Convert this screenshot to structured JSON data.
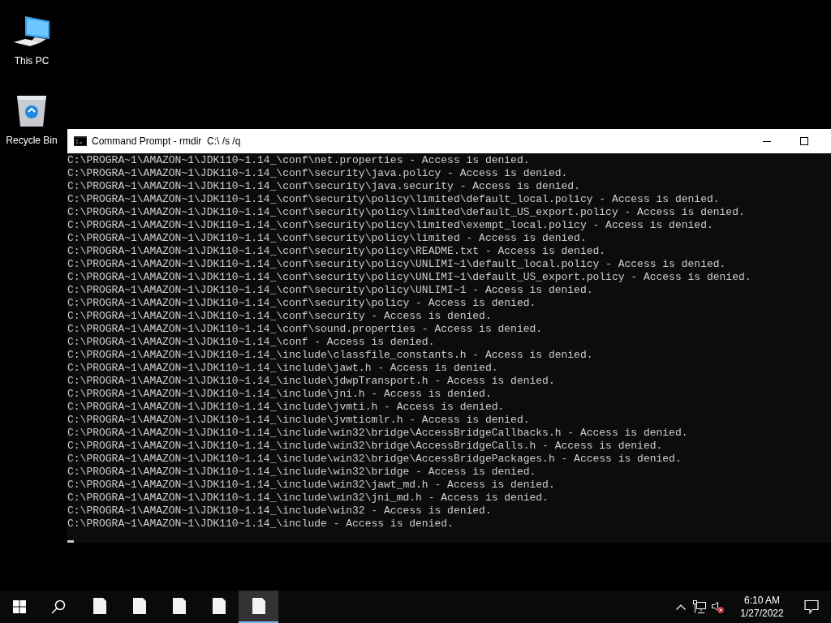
{
  "desktop_icons": [
    {
      "kind": "computer",
      "label": "This PC"
    },
    {
      "kind": "recycle",
      "label": "Recycle Bin"
    }
  ],
  "window": {
    "title": "Command Prompt - rmdir  C:\\ /s /q",
    "lines": [
      "C:\\PROGRA~1\\AMAZON~1\\JDK110~1.14_\\conf\\net.properties - Access is denied.",
      "C:\\PROGRA~1\\AMAZON~1\\JDK110~1.14_\\conf\\security\\java.policy - Access is denied.",
      "C:\\PROGRA~1\\AMAZON~1\\JDK110~1.14_\\conf\\security\\java.security - Access is denied.",
      "C:\\PROGRA~1\\AMAZON~1\\JDK110~1.14_\\conf\\security\\policy\\limited\\default_local.policy - Access is denied.",
      "C:\\PROGRA~1\\AMAZON~1\\JDK110~1.14_\\conf\\security\\policy\\limited\\default_US_export.policy - Access is denied.",
      "C:\\PROGRA~1\\AMAZON~1\\JDK110~1.14_\\conf\\security\\policy\\limited\\exempt_local.policy - Access is denied.",
      "C:\\PROGRA~1\\AMAZON~1\\JDK110~1.14_\\conf\\security\\policy\\limited - Access is denied.",
      "C:\\PROGRA~1\\AMAZON~1\\JDK110~1.14_\\conf\\security\\policy\\README.txt - Access is denied.",
      "C:\\PROGRA~1\\AMAZON~1\\JDK110~1.14_\\conf\\security\\policy\\UNLIMI~1\\default_local.policy - Access is denied.",
      "C:\\PROGRA~1\\AMAZON~1\\JDK110~1.14_\\conf\\security\\policy\\UNLIMI~1\\default_US_export.policy - Access is denied.",
      "C:\\PROGRA~1\\AMAZON~1\\JDK110~1.14_\\conf\\security\\policy\\UNLIMI~1 - Access is denied.",
      "C:\\PROGRA~1\\AMAZON~1\\JDK110~1.14_\\conf\\security\\policy - Access is denied.",
      "C:\\PROGRA~1\\AMAZON~1\\JDK110~1.14_\\conf\\security - Access is denied.",
      "C:\\PROGRA~1\\AMAZON~1\\JDK110~1.14_\\conf\\sound.properties - Access is denied.",
      "C:\\PROGRA~1\\AMAZON~1\\JDK110~1.14_\\conf - Access is denied.",
      "C:\\PROGRA~1\\AMAZON~1\\JDK110~1.14_\\include\\classfile_constants.h - Access is denied.",
      "C:\\PROGRA~1\\AMAZON~1\\JDK110~1.14_\\include\\jawt.h - Access is denied.",
      "C:\\PROGRA~1\\AMAZON~1\\JDK110~1.14_\\include\\jdwpTransport.h - Access is denied.",
      "C:\\PROGRA~1\\AMAZON~1\\JDK110~1.14_\\include\\jni.h - Access is denied.",
      "C:\\PROGRA~1\\AMAZON~1\\JDK110~1.14_\\include\\jvmti.h - Access is denied.",
      "C:\\PROGRA~1\\AMAZON~1\\JDK110~1.14_\\include\\jvmticmlr.h - Access is denied.",
      "C:\\PROGRA~1\\AMAZON~1\\JDK110~1.14_\\include\\win32\\bridge\\AccessBridgeCallbacks.h - Access is denied.",
      "C:\\PROGRA~1\\AMAZON~1\\JDK110~1.14_\\include\\win32\\bridge\\AccessBridgeCalls.h - Access is denied.",
      "C:\\PROGRA~1\\AMAZON~1\\JDK110~1.14_\\include\\win32\\bridge\\AccessBridgePackages.h - Access is denied.",
      "C:\\PROGRA~1\\AMAZON~1\\JDK110~1.14_\\include\\win32\\bridge - Access is denied.",
      "C:\\PROGRA~1\\AMAZON~1\\JDK110~1.14_\\include\\win32\\jawt_md.h - Access is denied.",
      "C:\\PROGRA~1\\AMAZON~1\\JDK110~1.14_\\include\\win32\\jni_md.h - Access is denied.",
      "C:\\PROGRA~1\\AMAZON~1\\JDK110~1.14_\\include\\win32 - Access is denied.",
      "C:\\PROGRA~1\\AMAZON~1\\JDK110~1.14_\\include - Access is denied."
    ]
  },
  "taskbar": {
    "apps": [
      {
        "selected": false
      },
      {
        "selected": false
      },
      {
        "selected": false
      },
      {
        "selected": false
      },
      {
        "selected": true
      }
    ],
    "clock": {
      "time": "6:10 AM",
      "date": "1/27/2022"
    }
  }
}
